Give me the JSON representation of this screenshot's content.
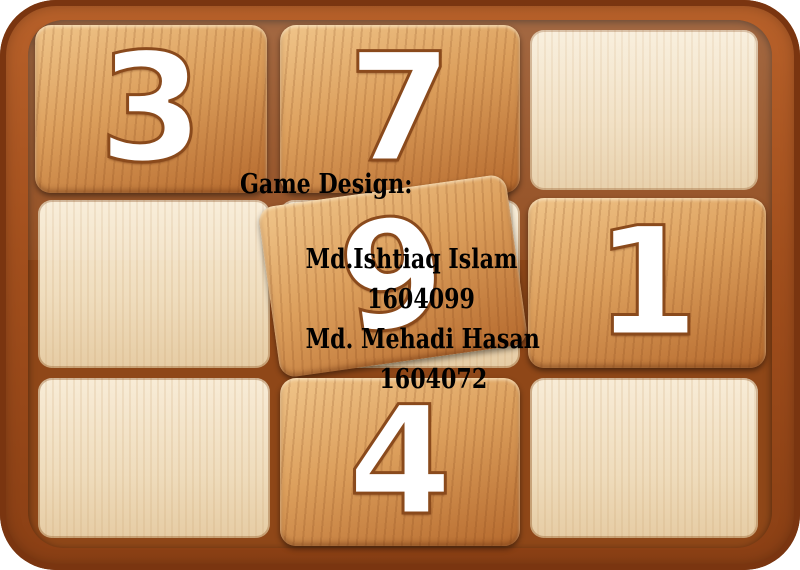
{
  "board": {
    "tiles": [
      {
        "label": "3"
      },
      {
        "label": "7"
      },
      {
        "label": "9"
      },
      {
        "label": "1"
      },
      {
        "label": "4"
      }
    ]
  },
  "credits": {
    "heading": "Game Design:",
    "designer1_name": "Md.Ishtiaq Islam",
    "designer1_id": "1604099",
    "designer2_name": "Md. Mehadi Hasan",
    "designer2_id": "1604072"
  }
}
